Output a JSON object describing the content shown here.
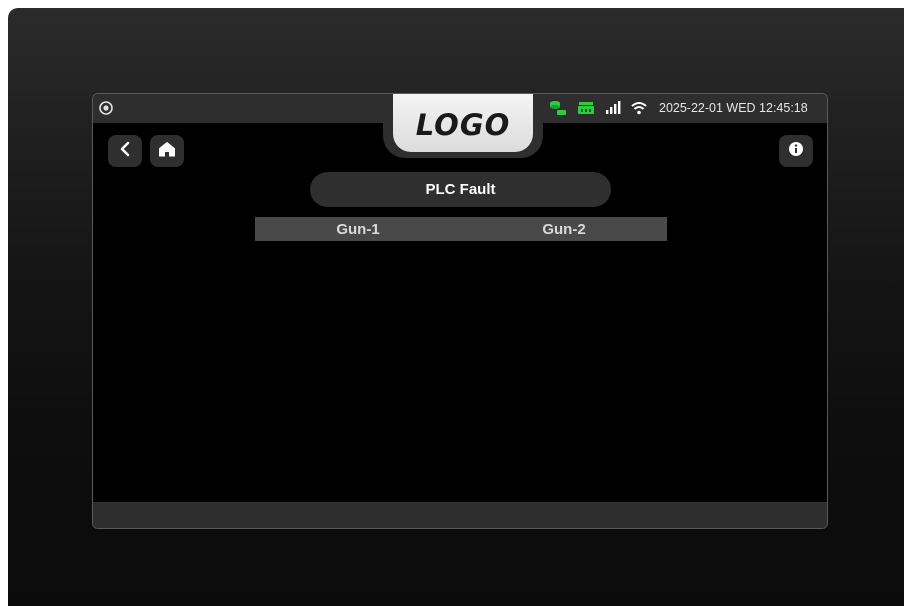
{
  "header": {
    "logo_text": "LOGO",
    "datetime": "2025-22-01 WED 12:45:18",
    "status_icons": [
      "database-icon",
      "network-icon",
      "signal-bars-icon",
      "wifi-icon"
    ],
    "status_colors": {
      "database": "#2ecc40",
      "network": "#2ecc40",
      "signal": "#ffffff",
      "wifi": "#ffffff"
    }
  },
  "nav": {
    "back_icon": "chevron-left-icon",
    "home_icon": "home-icon",
    "info_icon": "info-icon"
  },
  "page": {
    "title": "PLC Fault"
  },
  "table": {
    "columns": [
      "Gun-1",
      "Gun-2"
    ]
  }
}
